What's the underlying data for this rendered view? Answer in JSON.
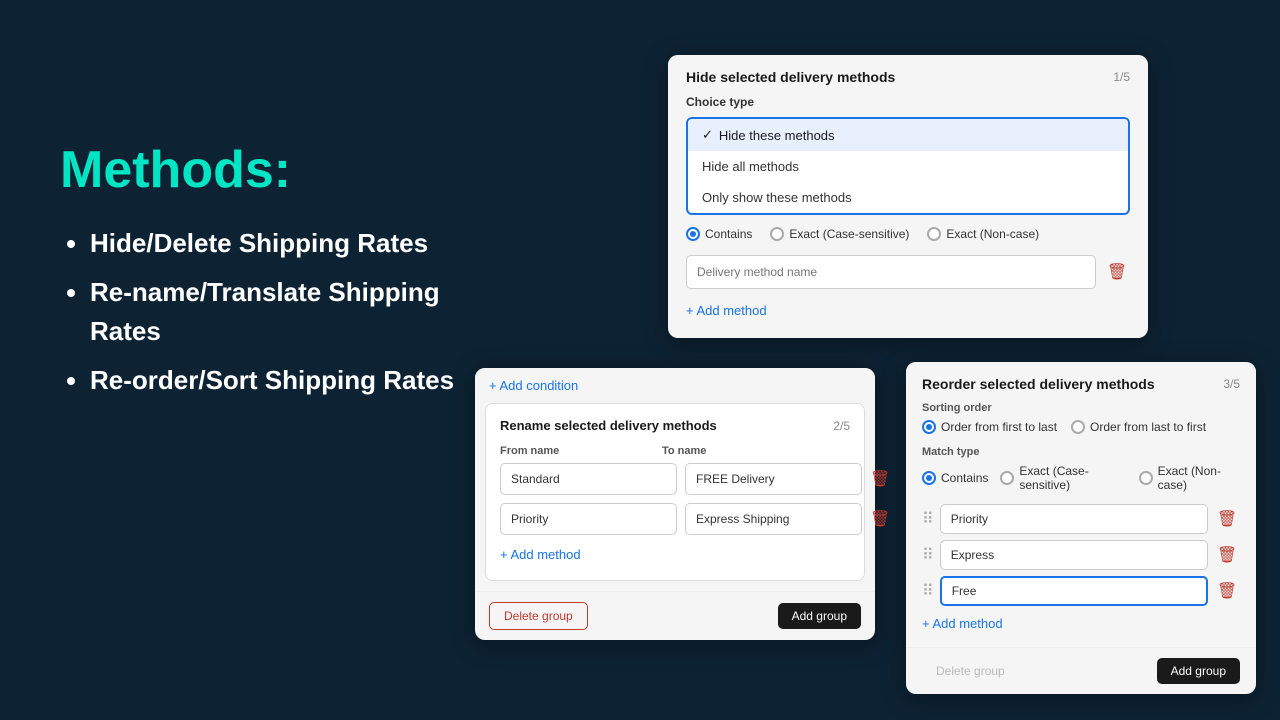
{
  "left": {
    "title": "Methods:",
    "items": [
      "Hide/Delete Shipping Rates",
      "Re-name/Translate Shipping Rates",
      "Re-order/Sort Shipping Rates"
    ]
  },
  "card1": {
    "title": "Hide selected delivery methods",
    "step": "1/5",
    "choice_type_label": "Choice type",
    "dropdown": {
      "items": [
        {
          "label": "Hide these methods",
          "selected": true
        },
        {
          "label": "Hide all methods",
          "selected": false
        },
        {
          "label": "Only show these methods",
          "selected": false
        }
      ]
    },
    "radios": [
      {
        "label": "Contains",
        "active": true
      },
      {
        "label": "Exact (Case-sensitive)",
        "active": false
      },
      {
        "label": "Exact (Non-case)",
        "active": false
      }
    ],
    "input_placeholder": "Delivery method name",
    "add_method": "+ Add method"
  },
  "card2": {
    "add_condition": "+ Add condition",
    "title": "Rename selected delivery methods",
    "step": "2/5",
    "from_label": "From name",
    "to_label": "To name",
    "rows": [
      {
        "from": "Standard",
        "to": "FREE Delivery"
      },
      {
        "from": "Priority",
        "to": "Express Shipping"
      }
    ],
    "add_method": "+ Add method",
    "delete_group": "Delete group",
    "add_group": "Add group"
  },
  "card3": {
    "title": "Reorder selected delivery methods",
    "step": "3/5",
    "sorting_label": "Sorting order",
    "sorting_radios": [
      {
        "label": "Order from first to last",
        "active": true
      },
      {
        "label": "Order from last to first",
        "active": false
      }
    ],
    "match_label": "Match type",
    "match_radios": [
      {
        "label": "Contains",
        "active": true
      },
      {
        "label": "Exact (Case-sensitive)",
        "active": false
      },
      {
        "label": "Exact (Non-case)",
        "active": false
      }
    ],
    "drag_items": [
      {
        "label": "Priority",
        "focused": false
      },
      {
        "label": "Express",
        "focused": false
      },
      {
        "label": "Free",
        "focused": true
      }
    ],
    "add_method": "+ Add method",
    "delete_group": "Delete group",
    "add_group": "Add group"
  }
}
